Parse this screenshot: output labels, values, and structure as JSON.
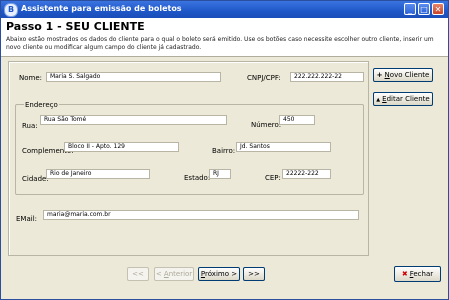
{
  "window": {
    "title": "Assistente para emissão de boletos"
  },
  "header": {
    "title": "Passo 1 - SEU CLIENTE",
    "description": "Abaixo estão mostrados os dados do cliente para o qual o boleto será emitido. Use os botões caso necessite escolher outro cliente, inserir um novo cliente ou modificar algum campo do cliente já cadastrado."
  },
  "form": {
    "nome": {
      "label": "Nome:",
      "value": "Maria S. Salgado"
    },
    "cnpj": {
      "label": "CNPJ/CPF:",
      "value": "222.222.222-22"
    },
    "endereco_legend": "Endereço",
    "rua": {
      "label": "Rua:",
      "value": "Rua São Tomé"
    },
    "numero": {
      "label": "Número:",
      "value": "450"
    },
    "complemento": {
      "label": "Complemento:",
      "value": "Bloco II - Apto. 129"
    },
    "bairro": {
      "label": "Bairro:",
      "value": "Jd. Santos"
    },
    "cidade": {
      "label": "Cidade:",
      "value": "Rio de Janeiro"
    },
    "estado": {
      "label": "Estado:",
      "value": "RJ"
    },
    "cep": {
      "label": "CEP:",
      "value": "22222-222"
    },
    "email": {
      "label": "EMail:",
      "value": "maria@maria.com.br"
    }
  },
  "side_buttons": {
    "novo_icon": "+",
    "novo_pre": "",
    "novo_u": "N",
    "novo_post": "ovo Cliente",
    "editar_icon": "▲",
    "editar_pre": "",
    "editar_u": "E",
    "editar_post": "ditar Cliente"
  },
  "nav": {
    "first": "<<",
    "prev_pre": "< ",
    "prev_u": "A",
    "prev_post": "nterior",
    "next_pre": "",
    "next_u": "P",
    "next_post": "róximo >",
    "last": ">>"
  },
  "close_button": {
    "icon": "✖",
    "u": "F",
    "post": "echar"
  },
  "colors": {
    "titlebar": "#1f57c8",
    "close_icon": "#cc0000"
  }
}
